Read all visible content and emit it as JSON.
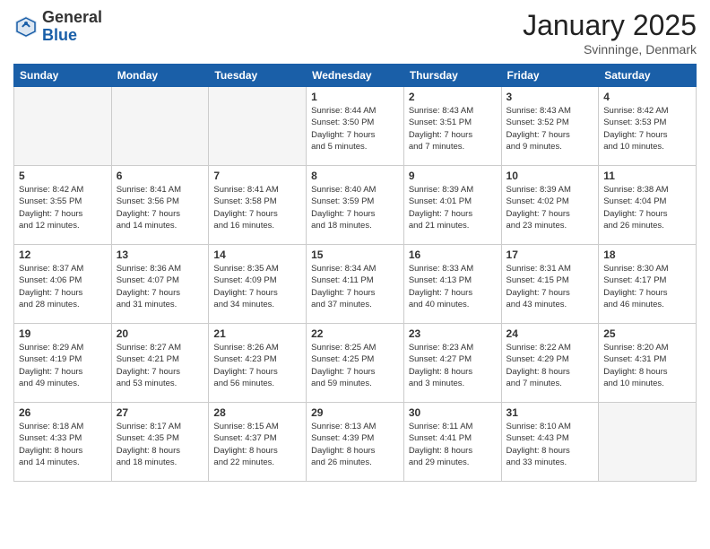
{
  "header": {
    "logo_general": "General",
    "logo_blue": "Blue",
    "month_title": "January 2025",
    "location": "Svinninge, Denmark"
  },
  "weekdays": [
    "Sunday",
    "Monday",
    "Tuesday",
    "Wednesday",
    "Thursday",
    "Friday",
    "Saturday"
  ],
  "weeks": [
    [
      {
        "day": "",
        "info": ""
      },
      {
        "day": "",
        "info": ""
      },
      {
        "day": "",
        "info": ""
      },
      {
        "day": "1",
        "info": "Sunrise: 8:44 AM\nSunset: 3:50 PM\nDaylight: 7 hours\nand 5 minutes."
      },
      {
        "day": "2",
        "info": "Sunrise: 8:43 AM\nSunset: 3:51 PM\nDaylight: 7 hours\nand 7 minutes."
      },
      {
        "day": "3",
        "info": "Sunrise: 8:43 AM\nSunset: 3:52 PM\nDaylight: 7 hours\nand 9 minutes."
      },
      {
        "day": "4",
        "info": "Sunrise: 8:42 AM\nSunset: 3:53 PM\nDaylight: 7 hours\nand 10 minutes."
      }
    ],
    [
      {
        "day": "5",
        "info": "Sunrise: 8:42 AM\nSunset: 3:55 PM\nDaylight: 7 hours\nand 12 minutes."
      },
      {
        "day": "6",
        "info": "Sunrise: 8:41 AM\nSunset: 3:56 PM\nDaylight: 7 hours\nand 14 minutes."
      },
      {
        "day": "7",
        "info": "Sunrise: 8:41 AM\nSunset: 3:58 PM\nDaylight: 7 hours\nand 16 minutes."
      },
      {
        "day": "8",
        "info": "Sunrise: 8:40 AM\nSunset: 3:59 PM\nDaylight: 7 hours\nand 18 minutes."
      },
      {
        "day": "9",
        "info": "Sunrise: 8:39 AM\nSunset: 4:01 PM\nDaylight: 7 hours\nand 21 minutes."
      },
      {
        "day": "10",
        "info": "Sunrise: 8:39 AM\nSunset: 4:02 PM\nDaylight: 7 hours\nand 23 minutes."
      },
      {
        "day": "11",
        "info": "Sunrise: 8:38 AM\nSunset: 4:04 PM\nDaylight: 7 hours\nand 26 minutes."
      }
    ],
    [
      {
        "day": "12",
        "info": "Sunrise: 8:37 AM\nSunset: 4:06 PM\nDaylight: 7 hours\nand 28 minutes."
      },
      {
        "day": "13",
        "info": "Sunrise: 8:36 AM\nSunset: 4:07 PM\nDaylight: 7 hours\nand 31 minutes."
      },
      {
        "day": "14",
        "info": "Sunrise: 8:35 AM\nSunset: 4:09 PM\nDaylight: 7 hours\nand 34 minutes."
      },
      {
        "day": "15",
        "info": "Sunrise: 8:34 AM\nSunset: 4:11 PM\nDaylight: 7 hours\nand 37 minutes."
      },
      {
        "day": "16",
        "info": "Sunrise: 8:33 AM\nSunset: 4:13 PM\nDaylight: 7 hours\nand 40 minutes."
      },
      {
        "day": "17",
        "info": "Sunrise: 8:31 AM\nSunset: 4:15 PM\nDaylight: 7 hours\nand 43 minutes."
      },
      {
        "day": "18",
        "info": "Sunrise: 8:30 AM\nSunset: 4:17 PM\nDaylight: 7 hours\nand 46 minutes."
      }
    ],
    [
      {
        "day": "19",
        "info": "Sunrise: 8:29 AM\nSunset: 4:19 PM\nDaylight: 7 hours\nand 49 minutes."
      },
      {
        "day": "20",
        "info": "Sunrise: 8:27 AM\nSunset: 4:21 PM\nDaylight: 7 hours\nand 53 minutes."
      },
      {
        "day": "21",
        "info": "Sunrise: 8:26 AM\nSunset: 4:23 PM\nDaylight: 7 hours\nand 56 minutes."
      },
      {
        "day": "22",
        "info": "Sunrise: 8:25 AM\nSunset: 4:25 PM\nDaylight: 7 hours\nand 59 minutes."
      },
      {
        "day": "23",
        "info": "Sunrise: 8:23 AM\nSunset: 4:27 PM\nDaylight: 8 hours\nand 3 minutes."
      },
      {
        "day": "24",
        "info": "Sunrise: 8:22 AM\nSunset: 4:29 PM\nDaylight: 8 hours\nand 7 minutes."
      },
      {
        "day": "25",
        "info": "Sunrise: 8:20 AM\nSunset: 4:31 PM\nDaylight: 8 hours\nand 10 minutes."
      }
    ],
    [
      {
        "day": "26",
        "info": "Sunrise: 8:18 AM\nSunset: 4:33 PM\nDaylight: 8 hours\nand 14 minutes."
      },
      {
        "day": "27",
        "info": "Sunrise: 8:17 AM\nSunset: 4:35 PM\nDaylight: 8 hours\nand 18 minutes."
      },
      {
        "day": "28",
        "info": "Sunrise: 8:15 AM\nSunset: 4:37 PM\nDaylight: 8 hours\nand 22 minutes."
      },
      {
        "day": "29",
        "info": "Sunrise: 8:13 AM\nSunset: 4:39 PM\nDaylight: 8 hours\nand 26 minutes."
      },
      {
        "day": "30",
        "info": "Sunrise: 8:11 AM\nSunset: 4:41 PM\nDaylight: 8 hours\nand 29 minutes."
      },
      {
        "day": "31",
        "info": "Sunrise: 8:10 AM\nSunset: 4:43 PM\nDaylight: 8 hours\nand 33 minutes."
      },
      {
        "day": "",
        "info": ""
      }
    ]
  ]
}
